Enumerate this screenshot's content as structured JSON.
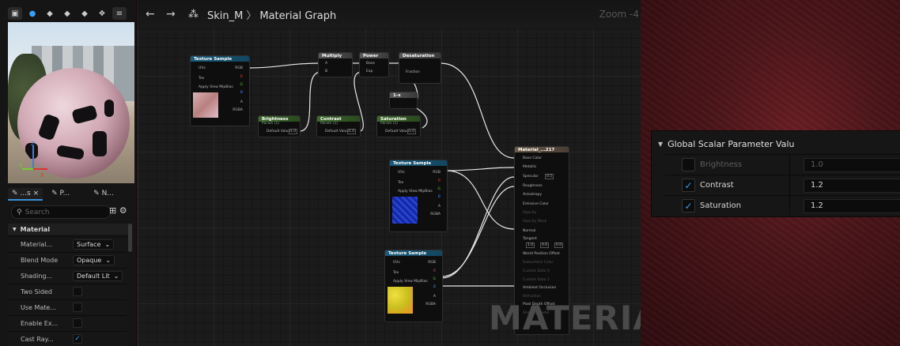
{
  "viewport_tabs": [
    {
      "label": "...s",
      "close": "×"
    },
    {
      "label": "P..."
    },
    {
      "label": "N..."
    }
  ],
  "details": {
    "search_placeholder": "Search",
    "section": "Material",
    "rows": [
      {
        "label": "Material...",
        "value": "Surface"
      },
      {
        "label": "Blend Mode",
        "value": "Opaque"
      },
      {
        "label": "Shading...",
        "value": "Default Lit"
      },
      {
        "label": "Two Sided",
        "checked": false
      },
      {
        "label": "Use Mate...",
        "checked": false
      },
      {
        "label": "Enable Ex...",
        "checked": false
      },
      {
        "label": "Cast Ray...",
        "checked": true
      }
    ]
  },
  "graph": {
    "nav_back": "←",
    "nav_forward": "→",
    "breadcrumb_asset": "Skin_M",
    "breadcrumb_sep": "〉",
    "breadcrumb_page": "Material Graph",
    "zoom": "Zoom -4",
    "watermark": "MATERIAL",
    "nodes": {
      "tex1_title": "Texture Sample",
      "tex2_title": "Texture Sample",
      "tex3_title": "Texture Sample",
      "uvs": "UVs",
      "tex": "Tex",
      "apply": "Apply View MipBias",
      "rgb": "RGB",
      "r": "R",
      "g": "G",
      "b": "B",
      "a": "A",
      "rgba": "RGBA",
      "multiply": "Multiply",
      "power": "Power",
      "desaturation": "Desaturation",
      "mult_a": "A",
      "mult_b": "B",
      "pow_base": "Base",
      "pow_exp": "Exp",
      "desat_fraction": "Fraction",
      "onem": "1-x",
      "brightness_title": "Brightness",
      "brightness_sub": "Param (1)",
      "contrast_title": "Contrast",
      "contrast_sub": "Param (1)",
      "saturation_title": "Saturation",
      "saturation_sub": "Param (1)",
      "default_value": "Default Value",
      "param_value": "1.0",
      "result_title": "Material_...217",
      "result_pins": [
        "Base Color",
        "Metallic",
        "Specular",
        "Roughness",
        "Anisotropy",
        "Emissive Color",
        "Opacity",
        "Opacity Mask",
        "Normal",
        "Tangent",
        "World Position Offset",
        "Subsurface Color",
        "Custom Data 0",
        "Custom Data 1",
        "Ambient Occlusion",
        "Refraction",
        "Pixel Depth Offset",
        "Shading Model"
      ],
      "specular_val": "0.5",
      "tangent_vals": [
        "1.0",
        "0.0",
        "0.0"
      ]
    }
  },
  "global_params": {
    "title": "Global Scalar Parameter Valu",
    "rows": [
      {
        "label": "Brightness",
        "value": "1.0",
        "checked": false
      },
      {
        "label": "Contrast",
        "value": "1.2",
        "checked": true
      },
      {
        "label": "Saturation",
        "value": "1.2",
        "checked": true
      }
    ]
  }
}
